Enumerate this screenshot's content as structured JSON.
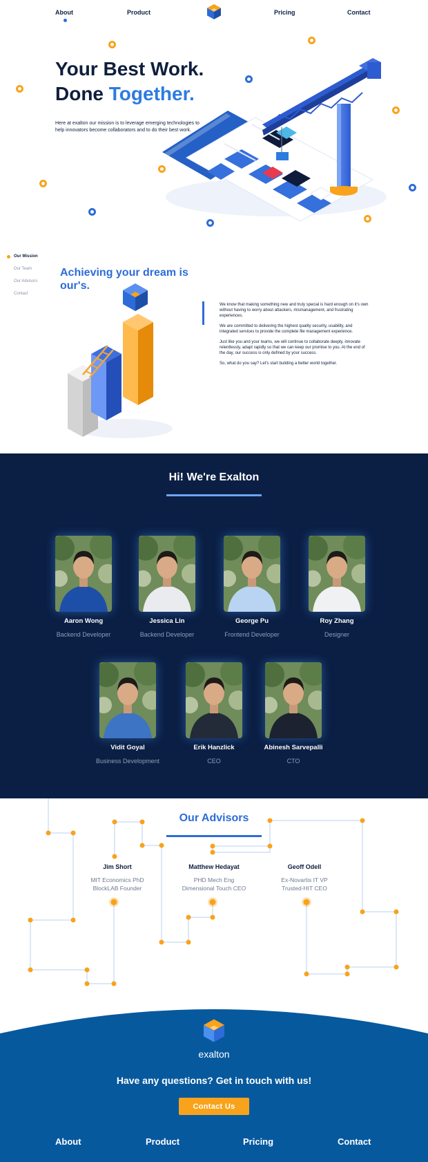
{
  "nav": {
    "about": "About",
    "product": "Product",
    "pricing": "Pricing",
    "contact": "Contact"
  },
  "hero": {
    "title_line1": "Your Best Work.",
    "title_line2_dark": "Done",
    "title_line2_blue": "Together.",
    "description": "Here at exalton our mission is to leverage emerging technologies to help innovators become collaborators and to do their best work."
  },
  "mission": {
    "side_nav": [
      "Our Mission",
      "Our Team",
      "Our Advisors",
      "Contact"
    ],
    "active_item": "Our Mission",
    "title": "Achieving your dream is our's.",
    "paragraphs": [
      "We know that making something new and truly special is hard enough on it's own without having to worry about attackers, mismanagement, and frustrating experiences.",
      "We are committed to delivering the highest quality security, usability, and integrated services to provide the complete file management experience.",
      "Just like you and your teams, we will continue to collaborate deeply, innovate relentlessly, adapt rapidly so that we can keep our promise to you. At the end of the day, our success is only defined by your success.",
      "So, what do you say? Let's start building a better world together."
    ]
  },
  "team": {
    "title": "Hi! We're Exalton",
    "members": [
      {
        "name": "Aaron Wong",
        "role": "Backend Developer",
        "shirt": "#1e4fa8"
      },
      {
        "name": "Jessica Lin",
        "role": "Backend Developer",
        "shirt": "#e9ebee"
      },
      {
        "name": "George Pu",
        "role": "Frontend Developer",
        "shirt": "#b9d4f2"
      },
      {
        "name": "Roy Zhang",
        "role": "Designer",
        "shirt": "#f0f1f3"
      },
      {
        "name": "Vidit Goyal",
        "role": "Business Development",
        "shirt": "#3d74c4"
      },
      {
        "name": "Erik Hanzlick",
        "role": "CEO",
        "shirt": "#232a38"
      },
      {
        "name": "Abinesh Sarvepalli",
        "role": "CTO",
        "shirt": "#1c2230"
      }
    ]
  },
  "advisors": {
    "title": "Our Advisors",
    "people": [
      {
        "name": "Jim Short",
        "line1": "MIT Economics PhD",
        "line2": "BlockLAB Founder"
      },
      {
        "name": "Matthew Hedayat",
        "line1": "PHD Mech Eng",
        "line2": "Dimensional Touch CEO"
      },
      {
        "name": "Geoff Odell",
        "line1": "Ex-Novartis IT VP",
        "line2": "Trusted-HIT CEO"
      }
    ]
  },
  "footer": {
    "brand": "exalton",
    "cta_text": "Have any questions? Get in touch with us!",
    "cta_button": "Contact Us",
    "nav": {
      "about": "About",
      "product": "Product",
      "pricing": "Pricing",
      "contact": "Contact"
    }
  },
  "colors": {
    "accent_blue": "#2d6cd8",
    "accent_orange": "#f8a31b",
    "navy": "#0b1f44",
    "footer_blue": "#07599e"
  }
}
